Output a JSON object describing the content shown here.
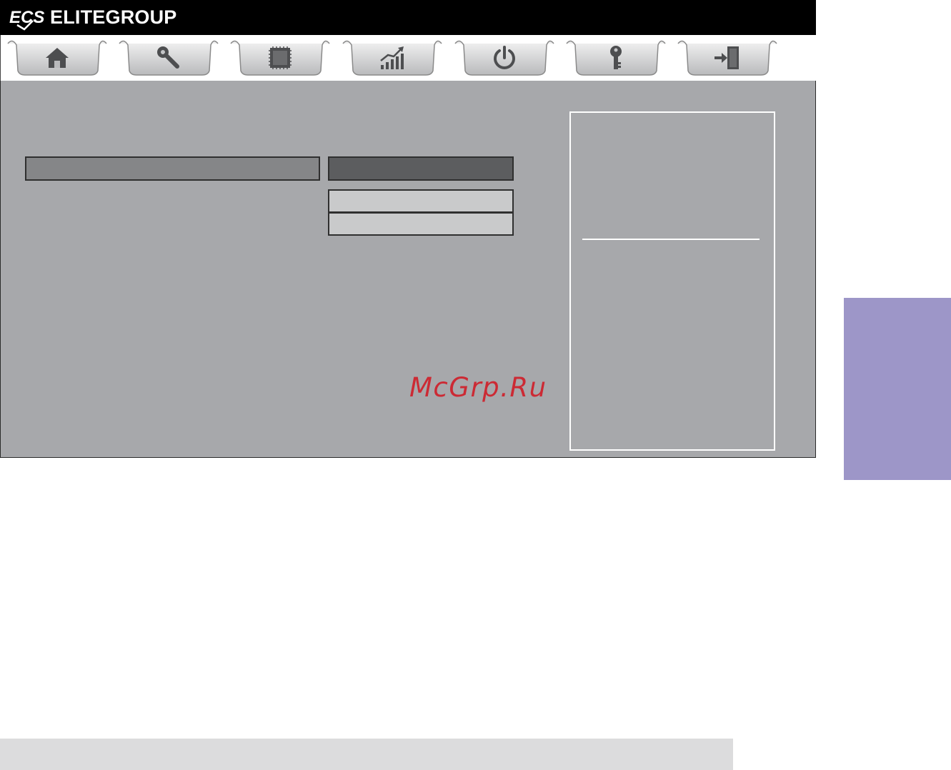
{
  "header": {
    "brand_logo": "ECS",
    "brand_name": "ELITEGROUP"
  },
  "tabs": [
    {
      "icon": "home-icon"
    },
    {
      "icon": "wrench-icon"
    },
    {
      "icon": "chip-icon"
    },
    {
      "icon": "performance-chart-icon"
    },
    {
      "icon": "power-icon"
    },
    {
      "icon": "key-icon"
    },
    {
      "icon": "exit-door-icon"
    }
  ],
  "watermark": "McGrp.Ru",
  "colors": {
    "header": "#000000",
    "panel": "#a7a8ab",
    "label_bar": "#858688",
    "value_bar": "#5c5d5f",
    "option": "#c9cacb",
    "side_tab": "#9d96c8",
    "watermark": "#cc2a34"
  }
}
